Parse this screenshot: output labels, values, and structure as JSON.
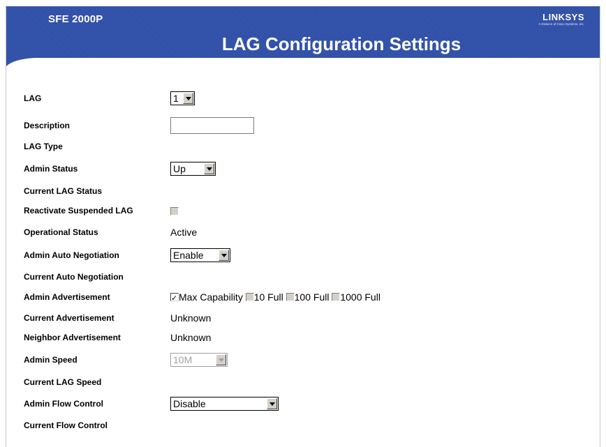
{
  "header": {
    "model": "SFE 2000P",
    "brand": "LINKSYS",
    "brand_sub": "A Division of Cisco Systems, Inc.",
    "title": "LAG Configuration Settings",
    "color": "#2f4fa8"
  },
  "form": {
    "lag": {
      "label": "LAG",
      "value": "1"
    },
    "description": {
      "label": "Description",
      "value": ""
    },
    "lag_type": {
      "label": "LAG Type"
    },
    "admin_status": {
      "label": "Admin Status",
      "value": "Up"
    },
    "current_lag_status": {
      "label": "Current LAG Status"
    },
    "reactivate": {
      "label": "Reactivate Suspended LAG",
      "checked": false
    },
    "operational_status": {
      "label": "Operational Status",
      "value": "Active"
    },
    "admin_auto_neg": {
      "label": "Admin Auto Negotiation",
      "value": "Enable"
    },
    "current_auto_neg": {
      "label": "Current Auto Negotiation"
    },
    "admin_advertisement": {
      "label": "Admin Advertisement",
      "options": [
        {
          "label": "Max Capability",
          "checked": true
        },
        {
          "label": "10 Full",
          "checked": false
        },
        {
          "label": "100 Full",
          "checked": false
        },
        {
          "label": "1000 Full",
          "checked": false
        }
      ]
    },
    "current_advertisement": {
      "label": "Current Advertisement",
      "value": "Unknown"
    },
    "neighbor_advertisement": {
      "label": "Neighbor Advertisement",
      "value": "Unknown"
    },
    "admin_speed": {
      "label": "Admin Speed",
      "value": "10M",
      "disabled": true
    },
    "current_lag_speed": {
      "label": "Current LAG Speed"
    },
    "admin_flow_control": {
      "label": "Admin Flow Control",
      "value": "Disable"
    },
    "current_flow_control": {
      "label": "Current Flow Control"
    }
  }
}
